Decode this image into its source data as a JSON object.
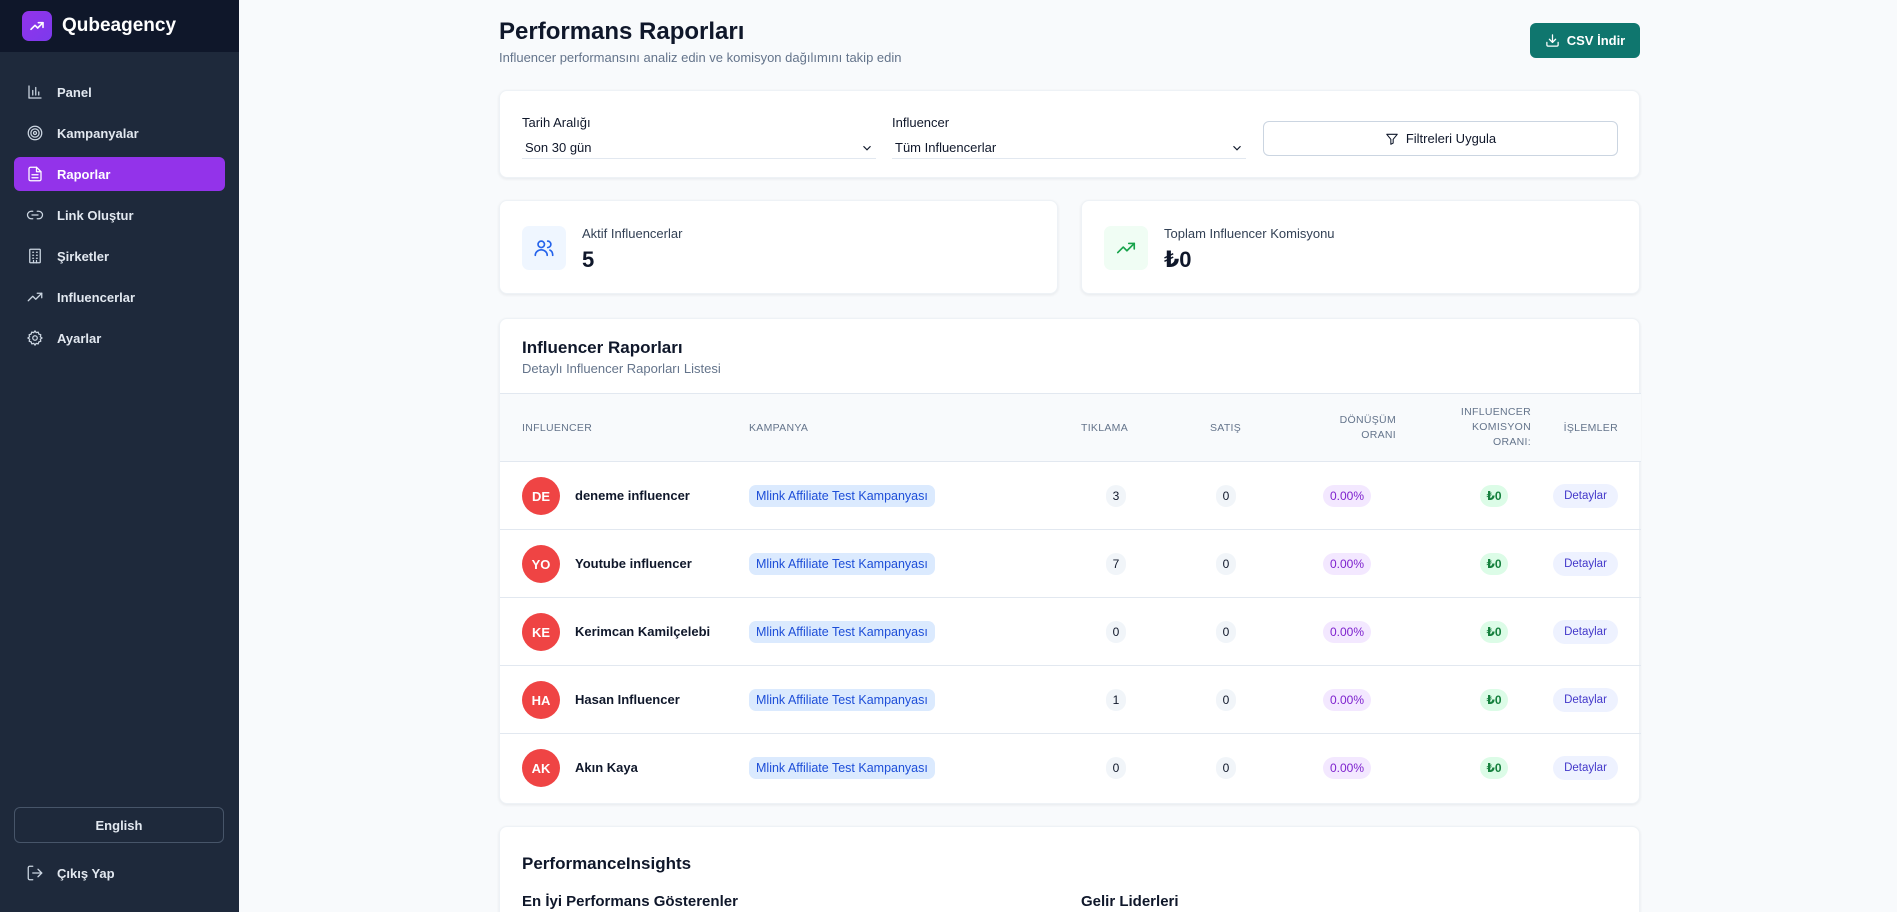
{
  "sidebar": {
    "brand": "Qubeagency",
    "items": [
      {
        "label": "Panel",
        "icon": "bar-chart-icon",
        "active": false
      },
      {
        "label": "Kampanyalar",
        "icon": "target-icon",
        "active": false
      },
      {
        "label": "Raporlar",
        "icon": "file-text-icon",
        "active": true
      },
      {
        "label": "Link Oluştur",
        "icon": "link-icon",
        "active": false
      },
      {
        "label": "Şirketler",
        "icon": "building-icon",
        "active": false
      },
      {
        "label": "Influencerlar",
        "icon": "trending-up-icon",
        "active": false
      },
      {
        "label": "Ayarlar",
        "icon": "gear-icon",
        "active": false
      }
    ],
    "language": "English",
    "logout": "Çıkış Yap",
    "accent": "#9333ea"
  },
  "header": {
    "title": "Performans Raporları",
    "subtitle": "Influencer performansını analiz edin ve komisyon dağılımını takip edin",
    "csv_label": "CSV İndir",
    "csv_color": "#0f766e"
  },
  "filters": {
    "date_label": "Tarih Aralığı",
    "date_value": "Son 30 gün",
    "influencer_label": "Influencer",
    "influencer_value": "Tüm Influencerlar",
    "apply_label": "Filtreleri Uygula"
  },
  "stats": {
    "active_label": "Aktif Influencerlar",
    "active_value": "5",
    "commission_label": "Toplam Influencer Komisyonu",
    "commission_value": "₺0"
  },
  "report": {
    "title": "Influencer Raporları",
    "subtitle": "Detaylı Influencer Raporları Listesi",
    "columns": {
      "influencer": "INFLUENCER",
      "campaign": "KAMPANYA",
      "clicks": "TIKLAMA",
      "sales": "SATIŞ",
      "conversion": "DÖNÜŞÜM ORANI",
      "commission": "INFLUENCER KOMISYON ORANI:",
      "actions": "İŞLEMLER"
    },
    "rows": [
      {
        "initials": "DE",
        "name": "deneme influencer",
        "campaign": "Mlink Affiliate Test Kampanyası",
        "clicks": "3",
        "sales": "0",
        "conversion": "0.00%",
        "commission": "₺0",
        "action": "Detaylar"
      },
      {
        "initials": "YO",
        "name": "Youtube influencer",
        "campaign": "Mlink Affiliate Test Kampanyası",
        "clicks": "7",
        "sales": "0",
        "conversion": "0.00%",
        "commission": "₺0",
        "action": "Detaylar"
      },
      {
        "initials": "KE",
        "name": "Kerimcan Kamilçelebi",
        "campaign": "Mlink Affiliate Test Kampanyası",
        "clicks": "0",
        "sales": "0",
        "conversion": "0.00%",
        "commission": "₺0",
        "action": "Detaylar"
      },
      {
        "initials": "HA",
        "name": "Hasan Influencer",
        "campaign": "Mlink Affiliate Test Kampanyası",
        "clicks": "1",
        "sales": "0",
        "conversion": "0.00%",
        "commission": "₺0",
        "action": "Detaylar"
      },
      {
        "initials": "AK",
        "name": "Akın Kaya",
        "campaign": "Mlink Affiliate Test Kampanyası",
        "clicks": "0",
        "sales": "0",
        "conversion": "0.00%",
        "commission": "₺0",
        "action": "Detaylar"
      }
    ]
  },
  "insights": {
    "title": "PerformanceInsights",
    "top_performers": "En İyi Performans Gösterenler",
    "revenue_leaders": "Gelir Liderleri"
  }
}
